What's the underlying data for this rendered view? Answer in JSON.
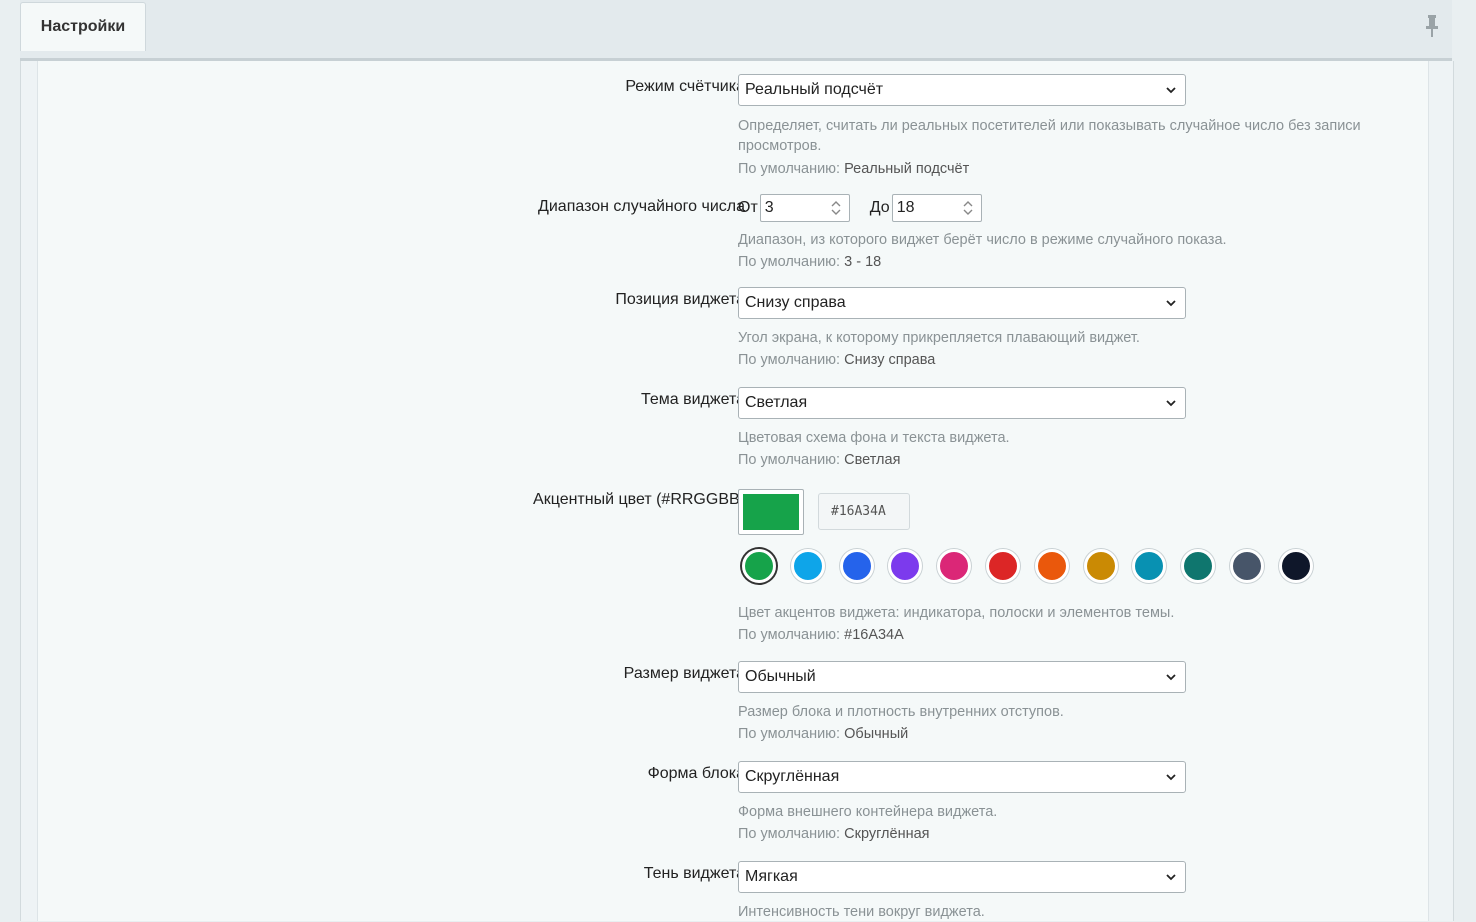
{
  "tab": {
    "label": "Настройки"
  },
  "settings": {
    "counter_mode": {
      "label": "Режим счётчика",
      "value": "Реальный подсчёт",
      "help": "Определяет, считать ли реальных посетителей или показывать случайное число без записи просмотров.",
      "default_prefix": "По умолчанию:",
      "default_value": "Реальный подсчёт"
    },
    "random_range": {
      "label": "Диапазон случайного числа",
      "from_label": "От",
      "from_value": "3",
      "to_label": "До",
      "to_value": "18",
      "help": "Диапазон, из которого виджет берёт число в режиме случайного показа.",
      "default_prefix": "По умолчанию:",
      "default_value": "3 - 18"
    },
    "position": {
      "label": "Позиция виджета",
      "value": "Снизу справа",
      "help": "Угол экрана, к которому прикрепляется плавающий виджет.",
      "default_prefix": "По умолчанию:",
      "default_value": "Снизу справа"
    },
    "theme": {
      "label": "Тема виджета",
      "value": "Светлая",
      "help": "Цветовая схема фона и текста виджета.",
      "default_prefix": "По умолчанию:",
      "default_value": "Светлая"
    },
    "accent": {
      "label": "Акцентный цвет (#RRGGBB)",
      "current_color": "#16A34A",
      "hex_value": "#16A34A",
      "presets": [
        "#16a34a",
        "#0ea5e9",
        "#2563eb",
        "#7c3aed",
        "#db2777",
        "#dc2626",
        "#ea580c",
        "#ca8a04",
        "#0891b2",
        "#0f766e",
        "#475569",
        "#0f172a"
      ],
      "selected_index": 0,
      "help": "Цвет акцентов виджета: индикатора, полоски и элементов темы.",
      "default_prefix": "По умолчанию:",
      "default_value": "#16A34A"
    },
    "size": {
      "label": "Размер виджета",
      "value": "Обычный",
      "help": "Размер блока и плотность внутренних отступов.",
      "default_prefix": "По умолчанию:",
      "default_value": "Обычный"
    },
    "shape": {
      "label": "Форма блока",
      "value": "Скруглённая",
      "help": "Форма внешнего контейнера виджета.",
      "default_prefix": "По умолчанию:",
      "default_value": "Скруглённая"
    },
    "shadow": {
      "label": "Тень виджета",
      "value": "Мягкая",
      "help": "Интенсивность тени вокруг виджета."
    }
  }
}
